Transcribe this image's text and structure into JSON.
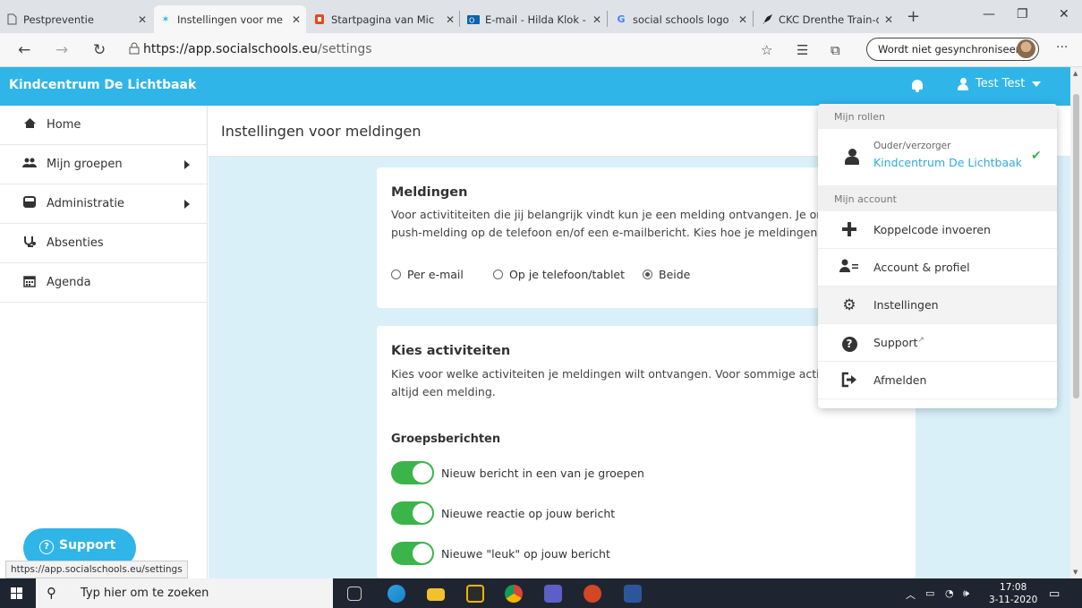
{
  "browser": {
    "tabs": [
      {
        "label": "Pestpreventie",
        "icon": "page-icon"
      },
      {
        "label": "Instellingen voor me",
        "icon": "socialschools-icon",
        "active": true
      },
      {
        "label": "Startpagina van Mic",
        "icon": "office-icon"
      },
      {
        "label": "E-mail - Hilda Klok -",
        "icon": "outlook-icon"
      },
      {
        "label": "social schools logo -",
        "icon": "google-icon"
      },
      {
        "label": "CKC Drenthe Train-d",
        "icon": "rocket-icon"
      }
    ],
    "url_host": "https://app.socialschools.eu",
    "url_path": "/settings",
    "sync_label": "Wordt niet gesynchroniseerd"
  },
  "header": {
    "brand": "Kindcentrum De Lichtbaak",
    "user_name": "Test Test"
  },
  "sidebar": {
    "items": [
      {
        "label": "Home",
        "icon": "home-icon"
      },
      {
        "label": "Mijn groepen",
        "icon": "groups-icon"
      },
      {
        "label": "Administratie",
        "icon": "inbox-icon"
      },
      {
        "label": "Absenties",
        "icon": "stethoscope-icon"
      },
      {
        "label": "Agenda",
        "icon": "calendar-icon"
      }
    ],
    "support_label": "Support",
    "status_url": "https://app.socialschools.eu/settings"
  },
  "main": {
    "title": "Instellingen voor meldingen",
    "meldingen": {
      "title": "Meldingen",
      "line1": "Voor activititeiten die jij belangrijk vindt kun je een melding ontvangen. Je ontva",
      "line2": "push-melding op de telefoon en/of een e-mailbericht. Kies hoe je meldingen wilt",
      "options": [
        "Per e-mail",
        "Op je telefoon/tablet",
        "Beide"
      ],
      "selected": "Beide"
    },
    "activiteiten": {
      "title": "Kies activiteiten",
      "line1": "Kies voor welke activiteiten je meldingen wilt ontvangen. Voor sommige activite",
      "line2": "altijd een melding.",
      "group_title": "Groepsberichten",
      "toggles": [
        {
          "label": "Nieuw bericht in een van je groepen",
          "on": true
        },
        {
          "label": "Nieuwe reactie op jouw bericht",
          "on": true
        },
        {
          "label": "Nieuwe \"leuk\" op jouw bericht",
          "on": true
        }
      ]
    }
  },
  "dropdown": {
    "roles_header": "Mijn rollen",
    "role_type": "Ouder/verzorger",
    "role_school": "Kindcentrum De Lichtbaak",
    "account_header": "Mijn account",
    "items": [
      {
        "label": "Koppelcode invoeren",
        "icon": "plus-icon"
      },
      {
        "label": "Account & profiel",
        "icon": "account-profile-icon"
      },
      {
        "label": "Instellingen",
        "icon": "gear-icon"
      },
      {
        "label": "Support",
        "icon": "question-circle-icon"
      },
      {
        "label": "Afmelden",
        "icon": "sign-out-icon"
      }
    ]
  },
  "taskbar": {
    "search_placeholder": "Typ hier om te zoeken",
    "time": "17:08",
    "date": "3-11-2020"
  },
  "colors": {
    "accent": "#30b5e8",
    "toggle_on": "#3bb54a",
    "link": "#30a9dc"
  }
}
